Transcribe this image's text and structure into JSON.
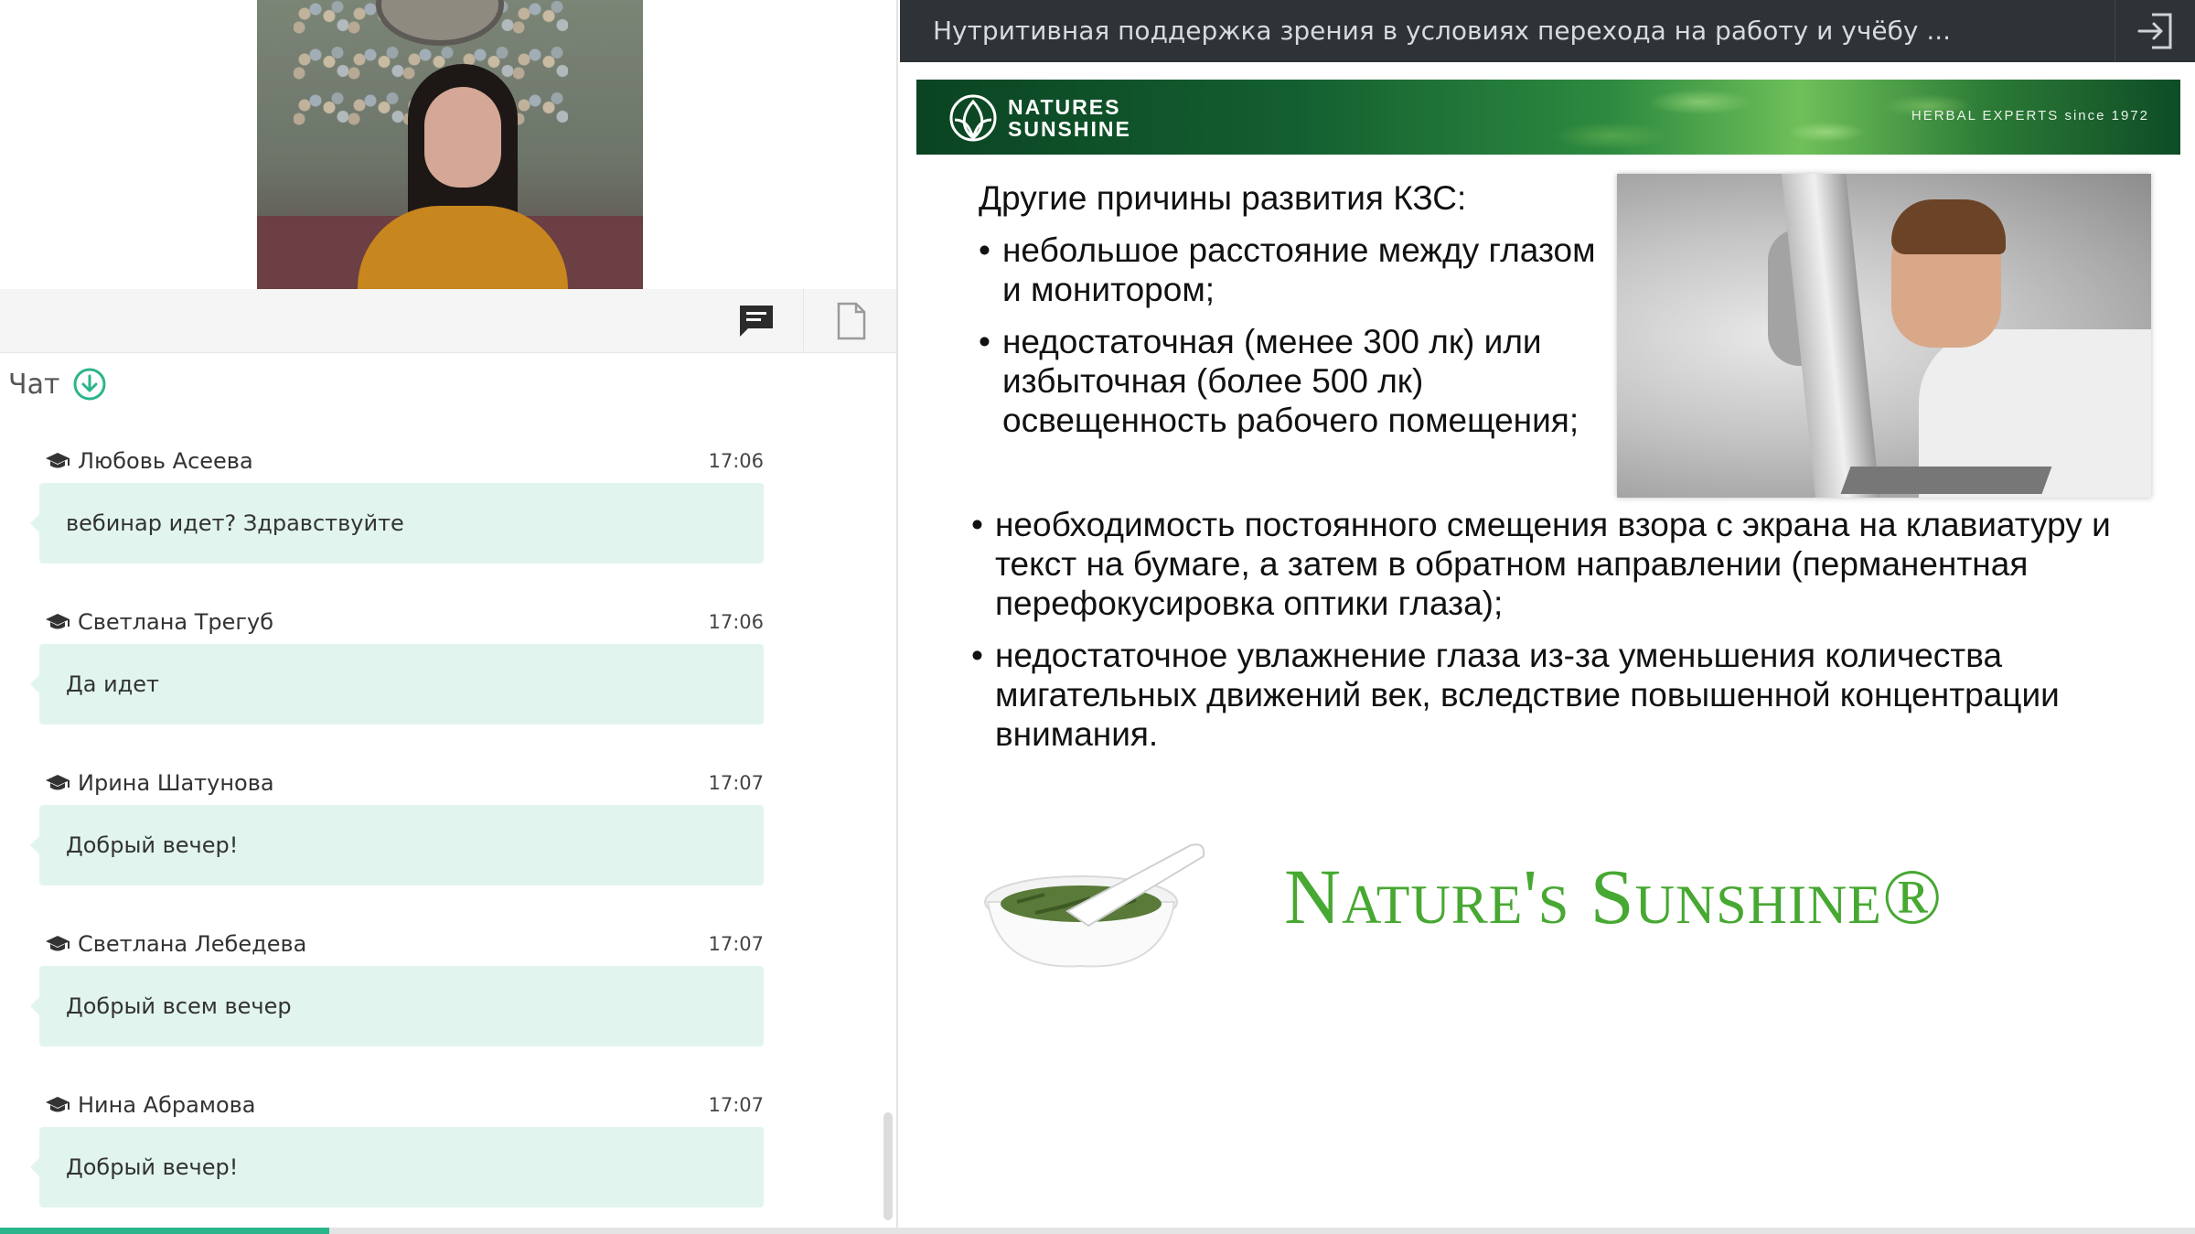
{
  "chat_panel": {
    "title": "Чат",
    "messages": [
      {
        "author": "Любовь Асеева",
        "time": "17:06",
        "text": "вебинар идет? Здравствуйте"
      },
      {
        "author": "Светлана Трегуб",
        "time": "17:06",
        "text": "Да идет"
      },
      {
        "author": "Ирина Шатунова",
        "time": "17:07",
        "text": "Добрый вечер!"
      },
      {
        "author": "Светлана Лебедева",
        "time": "17:07",
        "text": "Добрый всем вечер"
      },
      {
        "author": "Нина Абрамова",
        "time": "17:07",
        "text": "Добрый вечер!"
      }
    ]
  },
  "webinar": {
    "title": "Нутритивная поддержка зрения в условиях перехода на работу и учёбу ...",
    "progress_fraction": 0.15
  },
  "slide": {
    "banner_brand_line1": "NATURES",
    "banner_brand_line2": "SUNSHINE",
    "banner_tagline": "HERBAL EXPERTS since 1972",
    "heading": "Другие причины развития КЗС:",
    "bullets_top": [
      "небольшое расстояние между глазом и монитором;",
      "недостаточная (менее 300 лк) или избыточная (более 500 лк) освещенность рабочего помещения;"
    ],
    "bullets_bottom": [
      "необходимость постоянного смещения взора с экрана на клавиатуру и текст на бумаге, а затем в обратном направлении (перманентная перефокусировка оптики глаза);",
      "недостаточное увлажнение глаза из-за уменьшения количества мигательных движений век, вследствие повышенной концентрации внимания."
    ],
    "logo_text": "Nature's Sunshine®"
  },
  "colors": {
    "accent": "#2bb58b",
    "bubble": "#e1f5ee",
    "topbar": "#2e3337",
    "logo_green": "#47a832"
  },
  "icons": {
    "chat_tab": "chat-bubble-icon",
    "doc_tab": "document-icon",
    "download": "download-circle-icon",
    "author": "graduation-cap-icon",
    "exit": "exit-icon"
  }
}
